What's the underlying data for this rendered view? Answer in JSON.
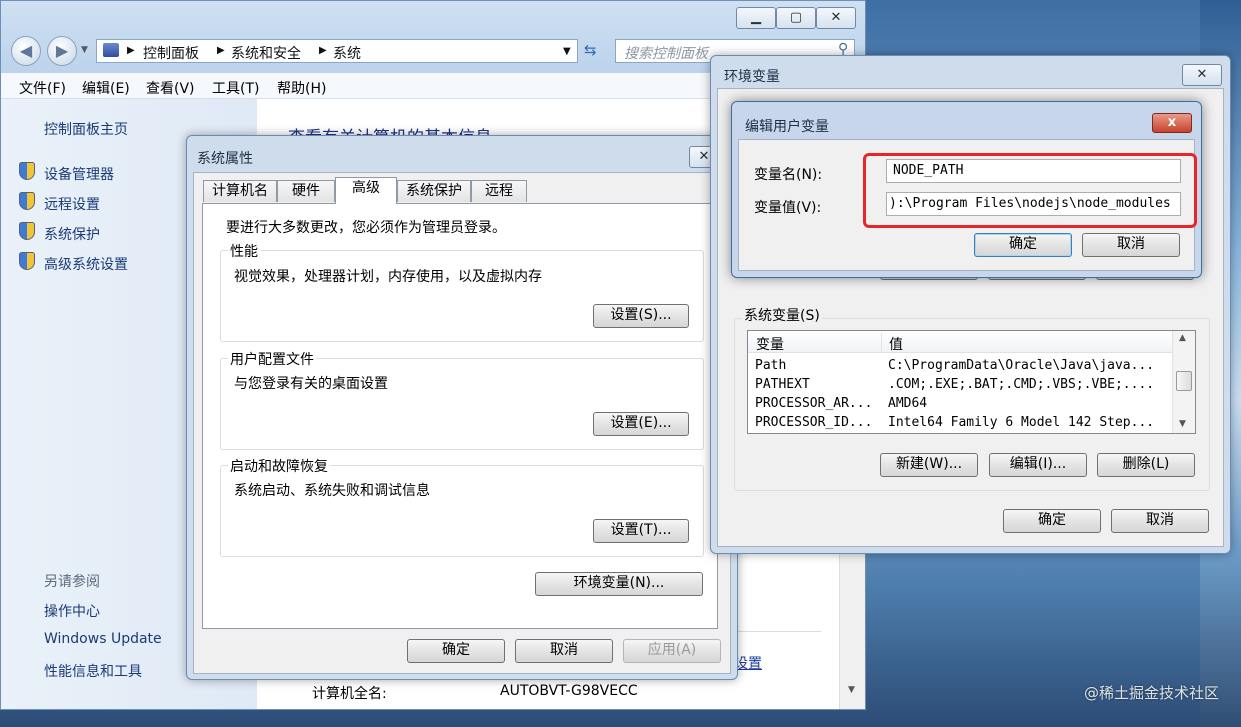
{
  "control_panel": {
    "breadcrumb": [
      "控制面板",
      "系统和安全",
      "系统"
    ],
    "search_placeholder": "搜索控制面板",
    "menu": [
      "文件(F)",
      "编辑(E)",
      "查看(V)",
      "工具(T)",
      "帮助(H)"
    ],
    "sidebar_home": "控制面板主页",
    "sidebar_links": [
      "设备管理器",
      "远程设置",
      "系统保护",
      "高级系统设置"
    ],
    "see_also_title": "另请参阅",
    "see_also": [
      "操作中心",
      "Windows Update",
      "性能信息和工具"
    ],
    "main_heading": "查看有关计算机的基本信息",
    "computer_fullname_label": "计算机全名:",
    "computer_fullname_value": "AUTOBVT-G98VECC",
    "settings_link_fragment": "设置"
  },
  "system_properties": {
    "title": "系统属性",
    "tabs": [
      "计算机名",
      "硬件",
      "高级",
      "系统保护",
      "远程"
    ],
    "admin_note": "要进行大多数更改，您必须作为管理员登录。",
    "groups": [
      {
        "title": "性能",
        "desc": "视觉效果，处理器计划，内存使用，以及虚拟内存",
        "button": "设置(S)..."
      },
      {
        "title": "用户配置文件",
        "desc": "与您登录有关的桌面设置",
        "button": "设置(E)..."
      },
      {
        "title": "启动和故障恢复",
        "desc": "系统启动、系统失败和调试信息",
        "button": "设置(T)..."
      }
    ],
    "env_button": "环境变量(N)...",
    "ok": "确定",
    "cancel": "取消",
    "apply": "应用(A)"
  },
  "environment_variables": {
    "title": "环境变量",
    "system_vars_label": "系统变量(S)",
    "columns": [
      "变量",
      "值"
    ],
    "rows": [
      [
        "Path",
        "C:\\ProgramData\\Oracle\\Java\\java..."
      ],
      [
        "PATHEXT",
        ".COM;.EXE;.BAT;.CMD;.VBS;.VBE;...."
      ],
      [
        "PROCESSOR_AR...",
        "AMD64"
      ],
      [
        "PROCESSOR_ID...",
        "Intel64 Family 6 Model 142 Step..."
      ]
    ],
    "new": "新建(W)...",
    "edit": "编辑(I)...",
    "delete": "删除(L)",
    "ok": "确定",
    "cancel": "取消"
  },
  "edit_user_variable": {
    "title": "编辑用户变量",
    "name_label": "变量名(N):",
    "value_label": "变量值(V):",
    "name_value": "NODE_PATH",
    "value_value": "):\\Program Files\\nodejs\\node_modules",
    "ok": "确定",
    "cancel": "取消",
    "close_glyph": "x"
  },
  "watermark": "@稀土掘金技术社区",
  "colors": {
    "highlight": "#e8262a",
    "link": "#1a3b77"
  }
}
